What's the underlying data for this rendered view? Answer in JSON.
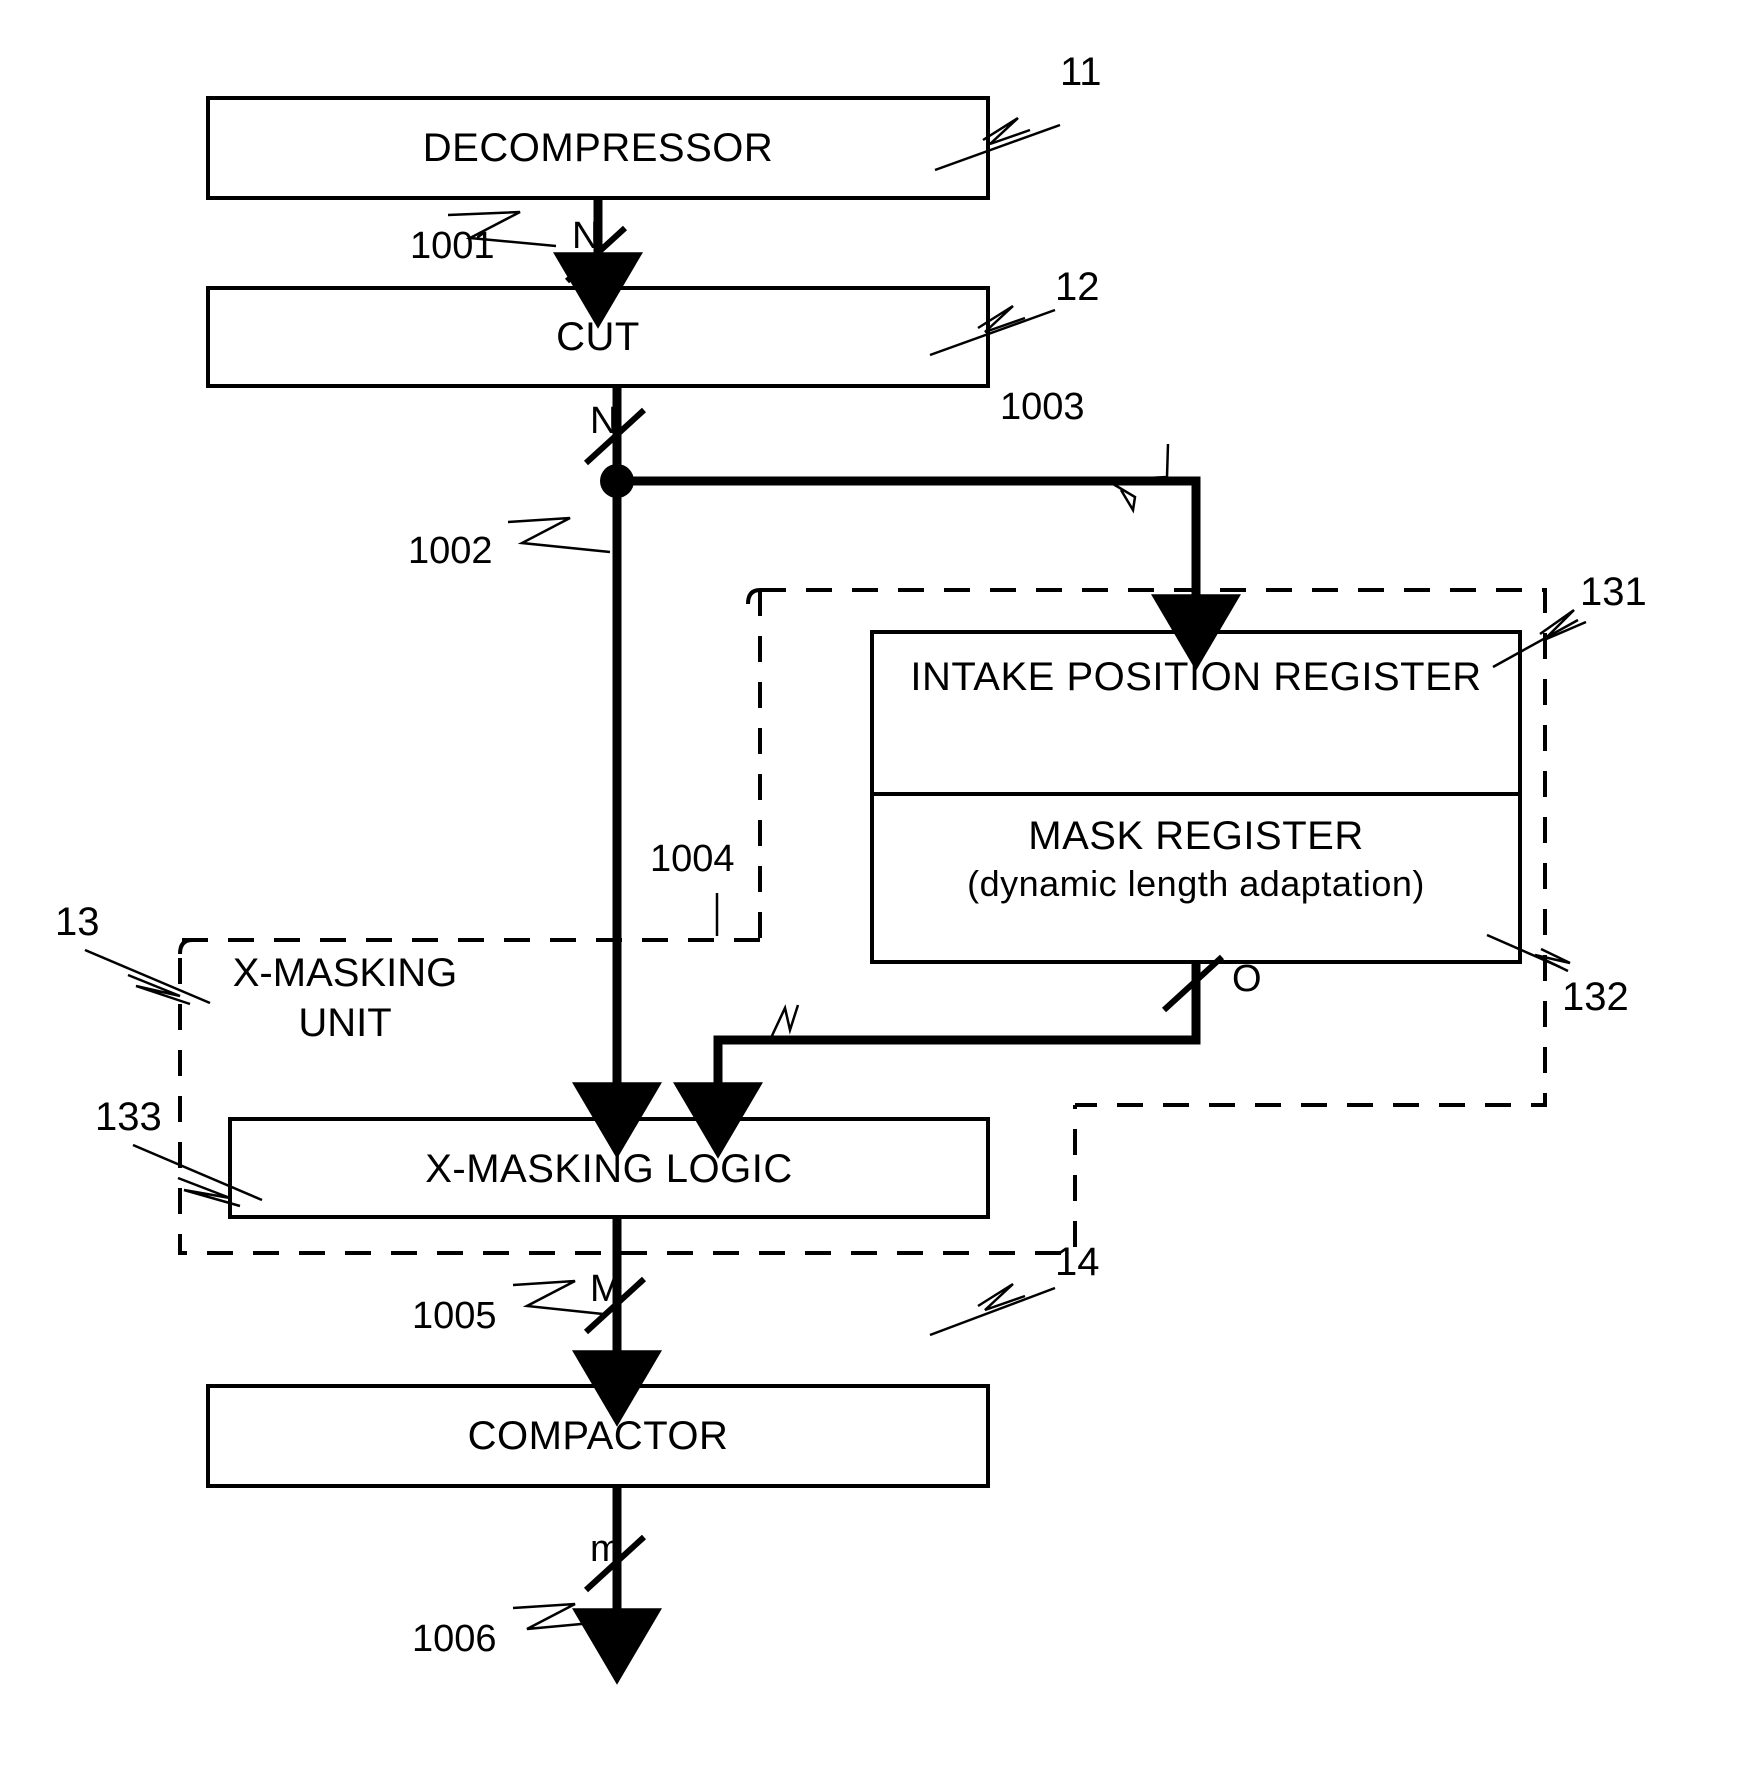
{
  "figure": {
    "kind": "patent-block-diagram",
    "background": "#ffffff",
    "line_color": "#000000"
  },
  "blocks": {
    "decompressor": {
      "label": "DECOMPRESSOR",
      "ref": "11"
    },
    "cut": {
      "label": "CUT",
      "ref": "12"
    },
    "intake_position_register": {
      "label": "INTAKE POSITION REGISTER",
      "ref": "131"
    },
    "mask_register": {
      "label_line1": "MASK REGISTER",
      "label_line2": "(dynamic length adaptation)",
      "ref": "132"
    },
    "x_masking_logic": {
      "label": "X-MASKING LOGIC",
      "ref": "133"
    },
    "compactor": {
      "label": "COMPACTOR",
      "ref": "14"
    }
  },
  "groups": {
    "x_masking_unit": {
      "label_line1": "X-MASKING",
      "label_line2": "UNIT",
      "ref": "13"
    },
    "register_group": {
      "ref_top": "131",
      "ref_bottom": "132"
    }
  },
  "signals": [
    {
      "id": "1001",
      "ref": "1001",
      "width": "N"
    },
    {
      "id": "1002",
      "ref": "1002",
      "width": "N"
    },
    {
      "id": "1003",
      "ref": "1003",
      "width": ""
    },
    {
      "id": "1004",
      "ref": "1004",
      "width": ""
    },
    {
      "id": "1005",
      "ref": "1005",
      "width": "M"
    },
    {
      "id": "1006",
      "ref": "1006",
      "width": "m"
    }
  ],
  "bus_widths": {
    "decompressor_out": "N",
    "cut_out": "N",
    "mask_register_out": "O",
    "masking_logic_out": "M",
    "compactor_out": "m"
  }
}
